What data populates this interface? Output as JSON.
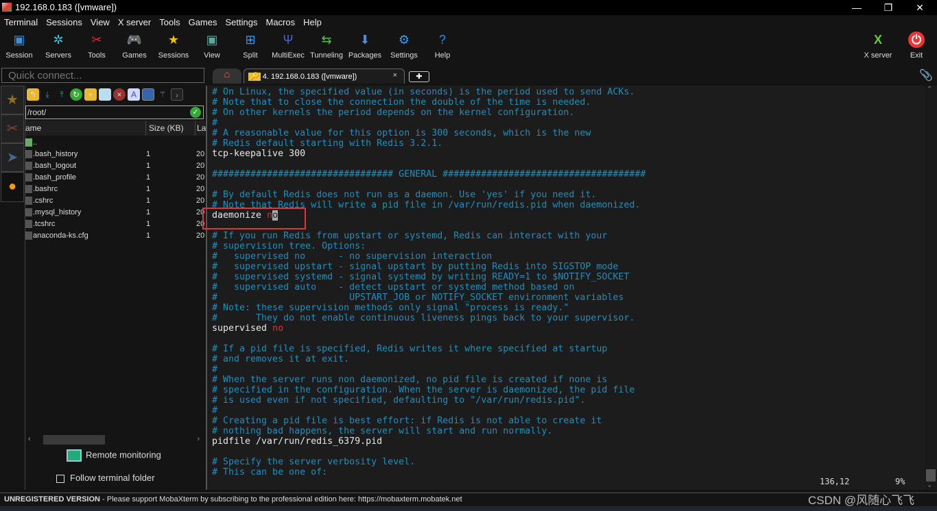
{
  "window": {
    "title": "192.168.0.183 ([vmware])",
    "minimize": "—",
    "restore": "❐",
    "close": "✕"
  },
  "menu": [
    "Terminal",
    "Sessions",
    "View",
    "X server",
    "Tools",
    "Games",
    "Settings",
    "Macros",
    "Help"
  ],
  "toolbar": [
    {
      "label": "Session",
      "icon": "session-icon",
      "glyph": "▣",
      "color": "#3b8fd9"
    },
    {
      "label": "Servers",
      "icon": "servers-icon",
      "glyph": "✲",
      "color": "#3bc0e0"
    },
    {
      "label": "Tools",
      "icon": "tools-icon",
      "glyph": "✂",
      "color": "#d33"
    },
    {
      "label": "Games",
      "icon": "games-icon",
      "glyph": "🎮",
      "color": "#ccc"
    },
    {
      "label": "Sessions",
      "icon": "star-icon",
      "glyph": "★",
      "color": "#f2c200"
    },
    {
      "label": "View",
      "icon": "view-icon",
      "glyph": "▣",
      "color": "#5a9"
    },
    {
      "label": "Split",
      "icon": "split-icon",
      "glyph": "⊞",
      "color": "#39f"
    },
    {
      "label": "MultiExec",
      "icon": "multiexec-icon",
      "glyph": "Ψ",
      "color": "#46c"
    },
    {
      "label": "Tunneling",
      "icon": "tunneling-icon",
      "glyph": "⇆",
      "color": "#4c4"
    },
    {
      "label": "Packages",
      "icon": "packages-icon",
      "glyph": "⬇",
      "color": "#58c"
    },
    {
      "label": "Settings",
      "icon": "settings-icon",
      "glyph": "⚙",
      "color": "#39f"
    },
    {
      "label": "Help",
      "icon": "help-icon",
      "glyph": "?",
      "color": "#2a8ef0"
    }
  ],
  "toolbar_right": [
    {
      "label": "X server",
      "icon": "x-server-icon",
      "glyph": "X",
      "color": "#6c3"
    },
    {
      "label": "Exit",
      "icon": "power-icon",
      "glyph": "⏻",
      "color": "#e33"
    }
  ],
  "quick_connect": {
    "placeholder": "Quick connect..."
  },
  "tabs": {
    "home_icon": "home-icon",
    "active": "4. 192.168.0.183 ([vmware])",
    "close": "×",
    "new": "✚"
  },
  "files": {
    "path": "/root/",
    "columns": [
      "ame",
      "Size (KB)",
      "La"
    ],
    "rows": [
      {
        "name": "..",
        "size": "",
        "last": ""
      },
      {
        "name": ".bash_history",
        "size": "1",
        "last": "20"
      },
      {
        "name": ".bash_logout",
        "size": "1",
        "last": "20"
      },
      {
        "name": ".bash_profile",
        "size": "1",
        "last": "20"
      },
      {
        "name": ".bashrc",
        "size": "1",
        "last": "20"
      },
      {
        "name": ".cshrc",
        "size": "1",
        "last": "20"
      },
      {
        "name": ".mysql_history",
        "size": "1",
        "last": "20"
      },
      {
        "name": ".tcshrc",
        "size": "1",
        "last": "20"
      },
      {
        "name": "anaconda-ks.cfg",
        "size": "1",
        "last": "20"
      }
    ],
    "remote_monitoring": "Remote monitoring",
    "follow_folder": "Follow terminal folder"
  },
  "terminal": {
    "lines": [
      {
        "c": "# On Linux, the specified value (in seconds) is the period used to send ACKs."
      },
      {
        "c": "# Note that to close the connection the double of the time is needed."
      },
      {
        "c": "# On other kernels the period depends on the kernel configuration."
      },
      {
        "c": "#"
      },
      {
        "c": "# A reasonable value for this option is 300 seconds, which is the new"
      },
      {
        "c": "# Redis default starting with Redis 3.2.1."
      },
      {
        "k": "tcp-keepalive 300"
      },
      {},
      {
        "c": "################################# GENERAL #####################################"
      },
      {},
      {
        "c": "# By default Redis does not run as a daemon. Use 'yes' if you need it."
      },
      {
        "c": "# Note that Redis will write a pid file in /var/run/redis.pid when daemonized."
      },
      {
        "k": "daemonize ",
        "v": "n",
        "cur": "o"
      },
      {},
      {
        "c": "# If you run Redis from upstart or systemd, Redis can interact with your"
      },
      {
        "c": "# supervision tree. Options:"
      },
      {
        "c": "#   supervised no      - no supervision interaction"
      },
      {
        "c": "#   supervised upstart - signal upstart by putting Redis into SIGSTOP mode"
      },
      {
        "c": "#   supervised systemd - signal systemd by writing READY=1 to $NOTIFY_SOCKET"
      },
      {
        "c": "#   supervised auto    - detect upstart or systemd method based on"
      },
      {
        "c": "#                        UPSTART_JOB or NOTIFY_SOCKET environment variables"
      },
      {
        "c": "# Note: these supervision methods only signal \"process is ready.\""
      },
      {
        "c": "#       They do not enable continuous liveness pings back to your supervisor."
      },
      {
        "k": "supervised ",
        "v": "no"
      },
      {},
      {
        "c": "# If a pid file is specified, Redis writes it where specified at startup"
      },
      {
        "c": "# and removes it at exit."
      },
      {
        "c": "#"
      },
      {
        "c": "# When the server runs non daemonized, no pid file is created if none is"
      },
      {
        "c": "# specified in the configuration. When the server is daemonized, the pid file"
      },
      {
        "c": "# is used even if not specified, defaulting to \"/var/run/redis.pid\"."
      },
      {
        "c": "#"
      },
      {
        "c": "# Creating a pid file is best effort: if Redis is not able to create it"
      },
      {
        "c": "# nothing bad happens, the server will start and run normally."
      },
      {
        "k": "pidfile /var/run/redis_6379.pid"
      },
      {},
      {
        "c": "# Specify the server verbosity level."
      },
      {
        "c": "# This can be one of:"
      }
    ],
    "position": "136,12",
    "percent": "9%"
  },
  "status": {
    "bold": "UNREGISTERED VERSION",
    "text": "  -  Please support MobaXterm by subscribing to the professional edition here:  https://mobaxterm.mobatek.net"
  },
  "watermark": "CSDN @风随心飞飞"
}
